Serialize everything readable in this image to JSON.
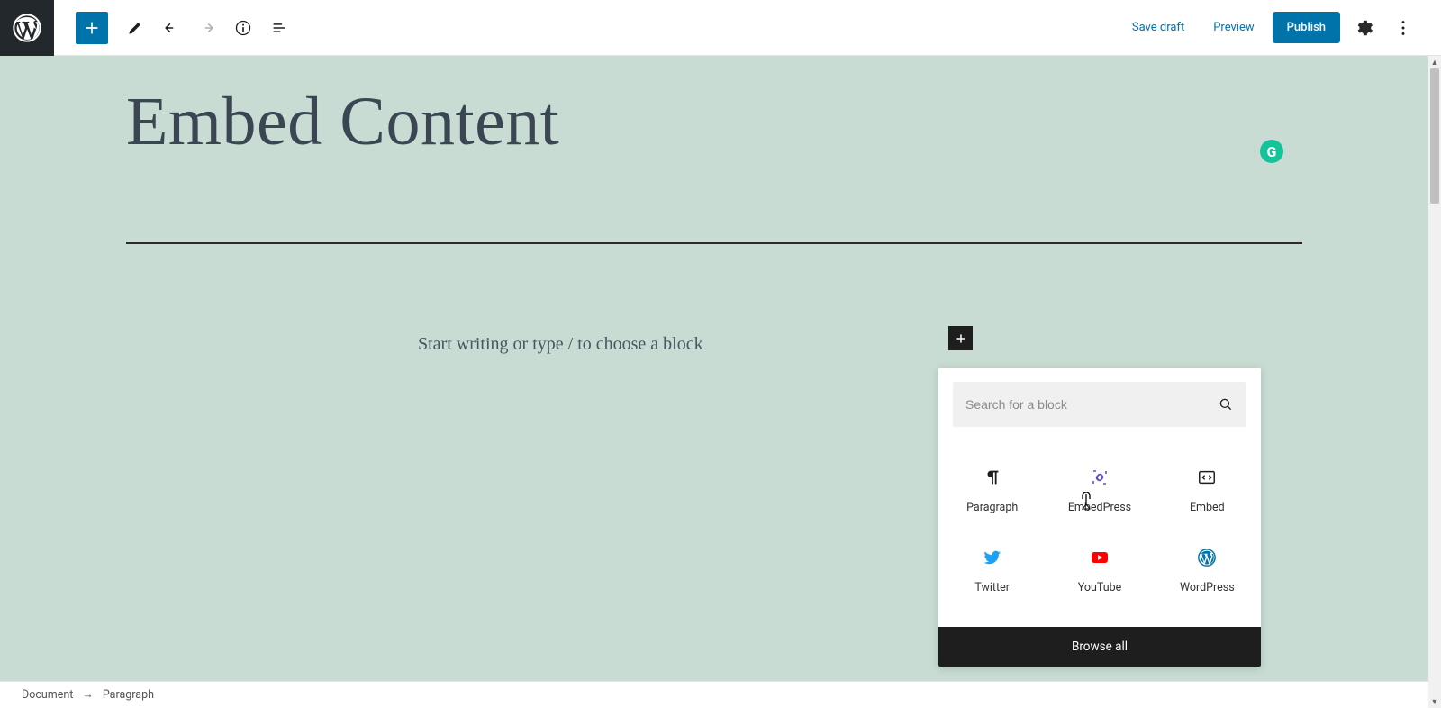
{
  "toolbar": {
    "save_draft": "Save draft",
    "preview": "Preview",
    "publish": "Publish"
  },
  "post": {
    "title": "Embed Content",
    "placeholder": "Start writing or type / to choose a block"
  },
  "inserter": {
    "search_placeholder": "Search for a block",
    "blocks": [
      {
        "label": "Paragraph",
        "icon": "paragraph"
      },
      {
        "label": "EmbedPress",
        "icon": "embedpress"
      },
      {
        "label": "Embed",
        "icon": "embed"
      },
      {
        "label": "Twitter",
        "icon": "twitter"
      },
      {
        "label": "YouTube",
        "icon": "youtube"
      },
      {
        "label": "WordPress",
        "icon": "wordpress"
      }
    ],
    "browse_all": "Browse all"
  },
  "breadcrumb": {
    "root": "Document",
    "current": "Paragraph"
  },
  "grammarly": "G"
}
